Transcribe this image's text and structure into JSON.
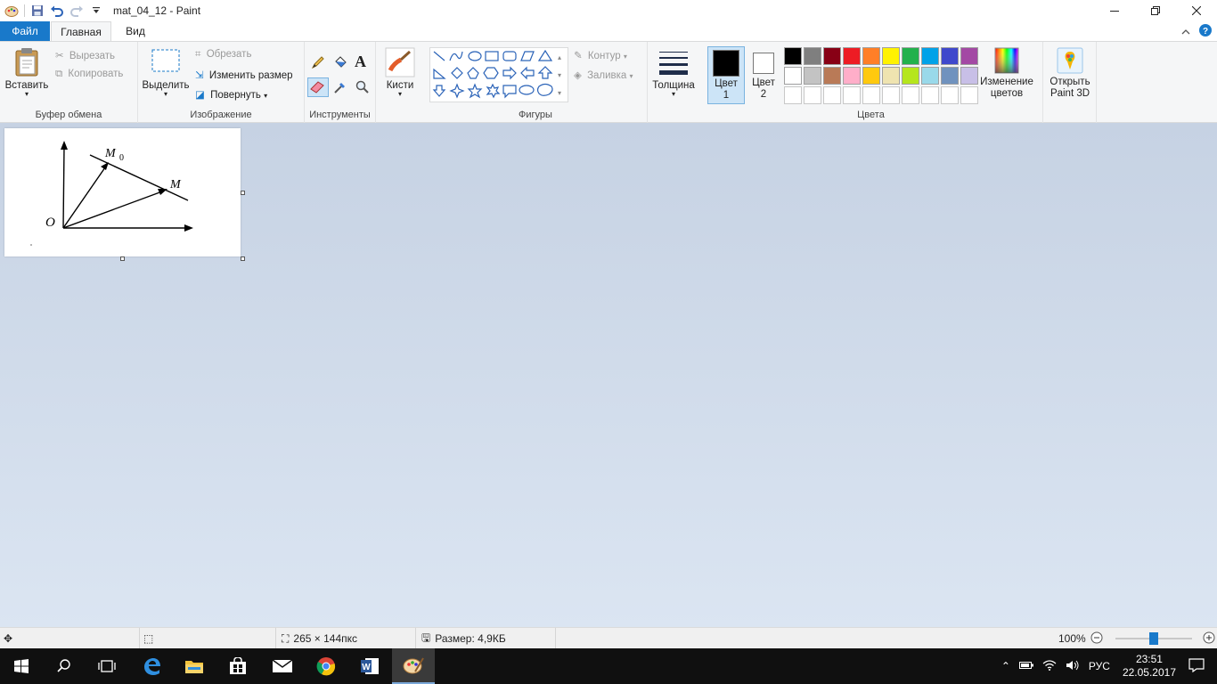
{
  "window": {
    "title": "mat_04_12 - Paint"
  },
  "tabs": {
    "file": "Файл",
    "home": "Главная",
    "view": "Вид"
  },
  "clipboard": {
    "paste": "Вставить",
    "cut": "Вырезать",
    "copy": "Копировать",
    "group": "Буфер обмена"
  },
  "image": {
    "select": "Выделить",
    "crop": "Обрезать",
    "resize": "Изменить размер",
    "rotate": "Повернуть",
    "group": "Изображение"
  },
  "tools": {
    "group": "Инструменты"
  },
  "brushes": {
    "label": "Кисти"
  },
  "shapes": {
    "outline": "Контур",
    "fill": "Заливка",
    "group": "Фигуры"
  },
  "thickness": {
    "label": "Толщина"
  },
  "colors": {
    "color1_line1": "Цвет",
    "color1_line2": "1",
    "color2_line1": "Цвет",
    "color2_line2": "2",
    "edit_line1": "Изменение",
    "edit_line2": "цветов",
    "group": "Цвета",
    "color1_value": "#000000",
    "color2_value": "#ffffff",
    "palette_row1": [
      "#000000",
      "#7f7f7f",
      "#880015",
      "#ed1c24",
      "#ff7f27",
      "#fff200",
      "#22b14c",
      "#00a2e8",
      "#3f48cc",
      "#a349a4"
    ],
    "palette_row2": [
      "#ffffff",
      "#c3c3c3",
      "#b97a57",
      "#ffaec9",
      "#ffc90e",
      "#efe4b0",
      "#b5e61d",
      "#99d9ea",
      "#7092be",
      "#c8bfe7"
    ]
  },
  "paint3d": {
    "line1": "Открыть",
    "line2": "Paint 3D"
  },
  "drawing": {
    "label_o": "O",
    "label_m0": "M",
    "label_m0_sub": "0",
    "label_m": "M"
  },
  "status": {
    "dimensions": "265 × 144пкс",
    "filesize": "Размер: 4,9КБ",
    "zoom": "100%"
  },
  "taskbar": {
    "language": "РУС",
    "time": "23:51",
    "date": "22.05.2017"
  }
}
